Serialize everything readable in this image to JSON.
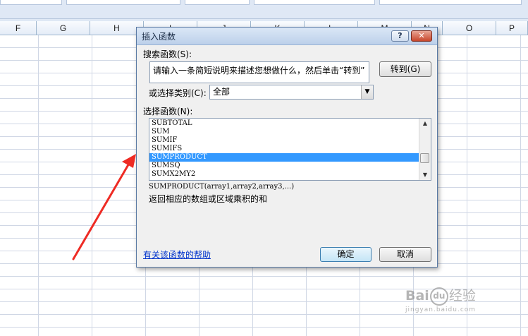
{
  "sheet": {
    "columns": [
      {
        "label": "F"
      },
      {
        "label": "G"
      },
      {
        "label": "H"
      },
      {
        "label": "I"
      },
      {
        "label": "J"
      },
      {
        "label": "K"
      },
      {
        "label": "L"
      },
      {
        "label": "M"
      },
      {
        "label": "N"
      },
      {
        "label": "O"
      },
      {
        "label": "P"
      }
    ]
  },
  "dialog": {
    "title": "插入函数",
    "help_button": "?",
    "close_button": "✕",
    "search_label": "搜索函数(S):",
    "search_value": "请输入一条简短说明来描述您想做什么，然后单击“转到”",
    "goto_button": "转到(G)",
    "category_label": "或选择类别(C):",
    "category_value": "全部",
    "function_label": "选择函数(N):",
    "functions": [
      "SUBTOTAL",
      "SUM",
      "SUMIF",
      "SUMIFS",
      "SUMPRODUCT",
      "SUMSQ",
      "SUMX2MY2"
    ],
    "selected_function": "SUMPRODUCT",
    "signature": "SUMPRODUCT(array1,array2,array3,...)",
    "description": "返回相应的数组或区域乘积的和",
    "help_link": "有关该函数的帮助",
    "ok_button": "确定",
    "cancel_button": "取消"
  },
  "annotation": {
    "arrow_color": "#ee2b24"
  },
  "watermark": {
    "brand": "Bai",
    "brand2": "du",
    "paw": "du",
    "cn": "经验",
    "sub": "jingyan.baidu.com"
  }
}
